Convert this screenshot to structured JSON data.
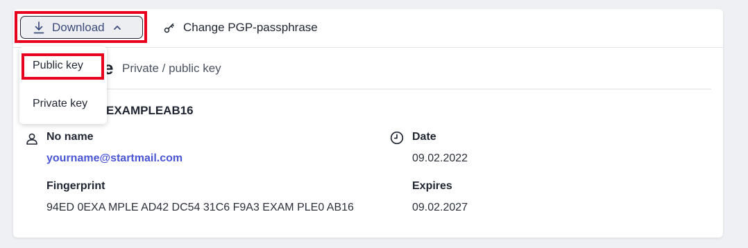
{
  "toolbar": {
    "download_label": "Download",
    "change_pgp_label": "Change PGP-passphrase"
  },
  "dropdown": {
    "items": [
      {
        "label": "Public key"
      },
      {
        "label": "Private key"
      }
    ]
  },
  "section": {
    "title_partial": "e",
    "subtitle": "Private / public key",
    "key_id_partial": "EXAMPLEAB16"
  },
  "details": {
    "name": "No name",
    "email": "yourname@startmail.com",
    "fingerprint_label": "Fingerprint",
    "fingerprint": "94ED 0EXA MPLE AD42 DC54 31C6 F9A3 EXAM PLE0 AB16",
    "date_label": "Date",
    "date": "09.02.2022",
    "expires_label": "Expires",
    "expires": "09.02.2027"
  },
  "colors": {
    "highlight": "#e8001c",
    "link": "#4a55d6"
  },
  "icons": [
    "download-icon",
    "chevron-up-icon",
    "key-icon",
    "user-icon",
    "clock-icon"
  ]
}
